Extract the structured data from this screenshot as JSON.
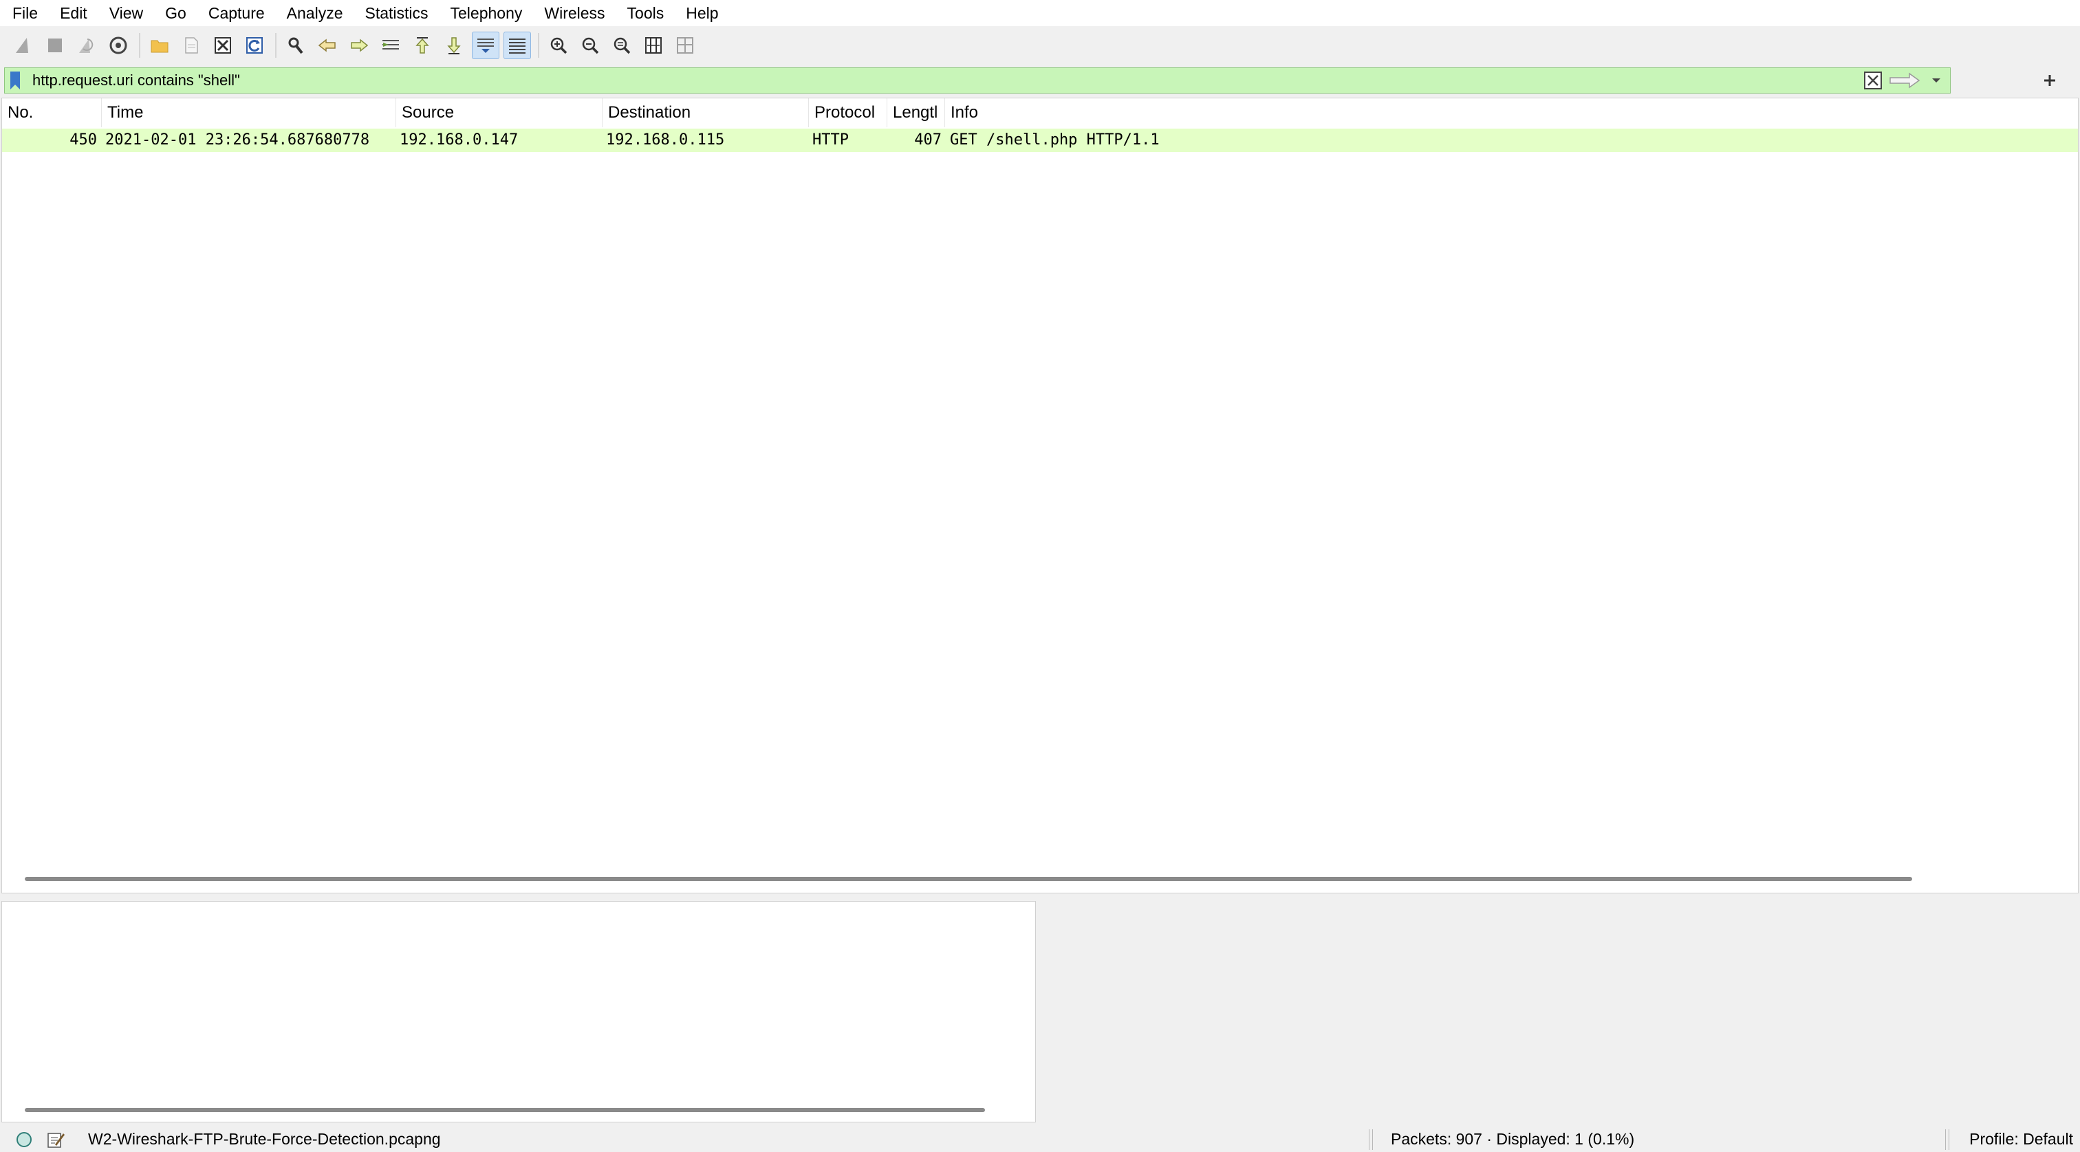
{
  "menu": [
    "File",
    "Edit",
    "View",
    "Go",
    "Capture",
    "Analyze",
    "Statistics",
    "Telephony",
    "Wireless",
    "Tools",
    "Help"
  ],
  "toolbar": [
    {
      "icon": "shark-fin-start-icon",
      "enabled": false
    },
    {
      "icon": "stop-square-icon",
      "enabled": false
    },
    {
      "icon": "restart-fin-icon",
      "enabled": false
    },
    {
      "icon": "capture-options-gear-icon",
      "enabled": true
    },
    {
      "icon": "open-folder-icon",
      "enabled": true
    },
    {
      "icon": "save-file-icon",
      "enabled": false
    },
    {
      "icon": "close-file-icon",
      "enabled": true
    },
    {
      "icon": "reload-icon",
      "enabled": true
    },
    {
      "icon": "find-packet-icon",
      "enabled": true
    },
    {
      "icon": "go-back-icon",
      "enabled": true
    },
    {
      "icon": "go-forward-icon",
      "enabled": true
    },
    {
      "icon": "go-to-packet-icon",
      "enabled": true
    },
    {
      "icon": "first-packet-icon",
      "enabled": true
    },
    {
      "icon": "last-packet-icon",
      "enabled": true
    },
    {
      "icon": "auto-scroll-icon",
      "enabled": true,
      "active": true
    },
    {
      "icon": "colorize-icon",
      "enabled": true,
      "active": true
    },
    {
      "icon": "zoom-in-icon",
      "enabled": true
    },
    {
      "icon": "zoom-out-icon",
      "enabled": true
    },
    {
      "icon": "normal-size-icon",
      "enabled": true
    },
    {
      "icon": "resize-columns-icon",
      "enabled": true
    },
    {
      "icon": "layout-panes-icon",
      "enabled": false
    }
  ],
  "filter": {
    "value": "http.request.uri contains \"shell\"",
    "bg_color": "#c8f5b8"
  },
  "columns": [
    "No.",
    "Time",
    "Source",
    "Destination",
    "Protocol",
    "Lengtl",
    "Info"
  ],
  "packets": [
    {
      "no": "450",
      "time": "2021-02-01 23:26:54.687680778",
      "source": "192.168.0.147",
      "destination": "192.168.0.115",
      "protocol": "HTTP",
      "length": "407",
      "info": "GET /shell.php HTTP/1.1",
      "row_color": "#e4ffc7"
    }
  ],
  "status": {
    "filename": "W2-Wireshark-FTP-Brute-Force-Detection.pcapng",
    "packets": "Packets: 907 · Displayed: 1 (0.1%)",
    "profile": "Profile: Default"
  }
}
